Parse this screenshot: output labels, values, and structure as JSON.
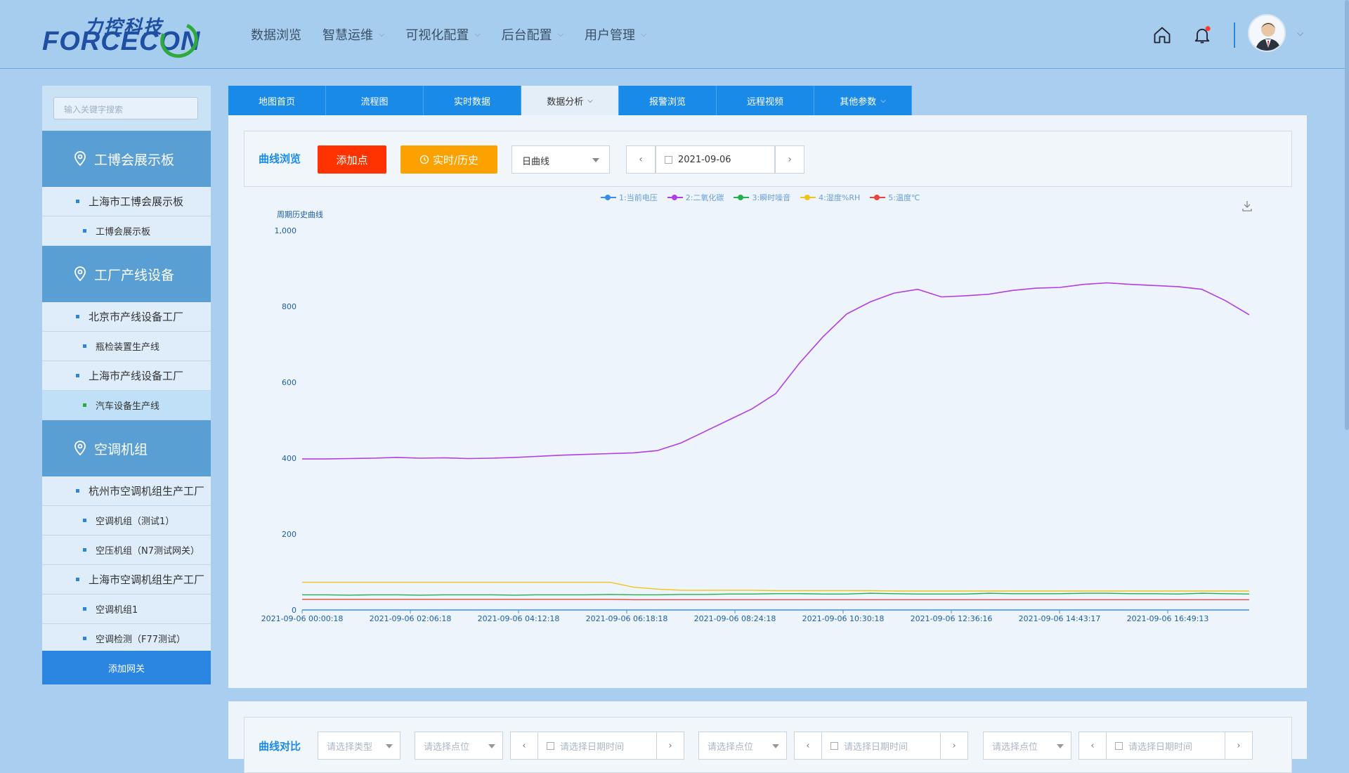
{
  "brand": {
    "cn": "力控科技",
    "en": "FORCECON"
  },
  "nav": [
    {
      "label": "数据浏览",
      "dropdown": false
    },
    {
      "label": "智慧运维",
      "dropdown": true
    },
    {
      "label": "可视化配置",
      "dropdown": true
    },
    {
      "label": "后台配置",
      "dropdown": true
    },
    {
      "label": "用户管理",
      "dropdown": true
    }
  ],
  "sidebar": {
    "search_placeholder": "输入关键字搜索",
    "groups": [
      {
        "title": "工博会展示板",
        "items": [
          {
            "label": "上海市工博会展示板",
            "level": 1
          },
          {
            "label": "工博会展示板",
            "level": 2
          }
        ]
      },
      {
        "title": "工厂产线设备",
        "items": [
          {
            "label": "北京市产线设备工厂",
            "level": 1
          },
          {
            "label": "瓶检装置生产线",
            "level": 2
          },
          {
            "label": "上海市产线设备工厂",
            "level": 1
          },
          {
            "label": "汽车设备生产线",
            "level": 2,
            "selected": true
          }
        ]
      },
      {
        "title": "空调机组",
        "items": [
          {
            "label": "杭州市空调机组生产工厂",
            "level": 1
          },
          {
            "label": "空调机组（测试1）",
            "level": 2
          },
          {
            "label": "空压机组（N7测试网关）",
            "level": 2
          },
          {
            "label": "上海市空调机组生产工厂",
            "level": 1
          },
          {
            "label": "空调机组1",
            "level": 2
          },
          {
            "label": "空调检测（F77测试）",
            "level": 2
          }
        ]
      }
    ],
    "add_button": "添加网关"
  },
  "tabs": [
    {
      "label": "地图首页"
    },
    {
      "label": "流程图"
    },
    {
      "label": "实时数据"
    },
    {
      "label": "数据分析",
      "active": true,
      "dropdown": true
    },
    {
      "label": "报警浏览"
    },
    {
      "label": "远程视频"
    },
    {
      "label": "其他参数",
      "dropdown": true
    }
  ],
  "toolbar": {
    "label": "曲线浏览",
    "add_point": "添加点",
    "realtime_history": "实时/历史",
    "curve_type": "日曲线",
    "date": "2021-09-06"
  },
  "chart_data": {
    "type": "line",
    "title": "周期历史曲线",
    "ylim": [
      0,
      1000
    ],
    "y_ticks": [
      "0",
      "200",
      "400",
      "600",
      "800",
      "1,000"
    ],
    "x_ticks": [
      "2021-09-06 00:00:18",
      "2021-09-06 02:06:18",
      "2021-09-06 04:12:18",
      "2021-09-06 06:18:18",
      "2021-09-06 08:24:18",
      "2021-09-06 10:30:18",
      "2021-09-06 12:36:16",
      "2021-09-06 14:43:17",
      "2021-09-06 16:49:13"
    ],
    "x": [
      0,
      1,
      2,
      3,
      4,
      5,
      6,
      7,
      8,
      9,
      10,
      11,
      12,
      13,
      14,
      15,
      16,
      17,
      18,
      19,
      20,
      21,
      22,
      23,
      24,
      25,
      26,
      27,
      28,
      29,
      30,
      31,
      32,
      33,
      34,
      35,
      36,
      37,
      38,
      39,
      40
    ],
    "series": [
      {
        "name": "1:当前电压",
        "color": "#3a8ee6",
        "values": [
          0,
          0,
          0,
          0,
          0,
          0,
          0,
          0,
          0,
          0,
          0,
          0,
          0,
          0,
          0,
          0,
          0,
          0,
          0,
          0,
          0,
          0,
          0,
          0,
          0,
          0,
          0,
          0,
          0,
          0,
          0,
          0,
          0,
          0,
          0,
          0,
          0,
          0,
          0,
          0,
          0
        ]
      },
      {
        "name": "2:二氧化碳",
        "color": "#b13ee6",
        "values": [
          398,
          398,
          399,
          400,
          402,
          400,
          401,
          399,
          400,
          402,
          405,
          408,
          410,
          412,
          414,
          420,
          440,
          470,
          500,
          530,
          570,
          650,
          720,
          780,
          812,
          835,
          845,
          825,
          828,
          832,
          842,
          848,
          850,
          858,
          862,
          858,
          855,
          852,
          845,
          815,
          778
        ]
      },
      {
        "name": "3:瞬时噪音",
        "color": "#22b14c",
        "values": [
          40,
          40,
          39,
          40,
          40,
          39,
          40,
          40,
          40,
          39,
          40,
          40,
          40,
          41,
          40,
          40,
          41,
          41,
          42,
          42,
          43,
          43,
          42,
          42,
          44,
          43,
          42,
          42,
          42,
          44,
          43,
          43,
          43,
          44,
          44,
          43,
          43,
          42,
          44,
          43,
          42
        ]
      },
      {
        "name": "4:湿度%RH",
        "color": "#f0c419",
        "values": [
          73,
          73,
          73,
          73,
          73,
          73,
          73,
          73,
          73,
          73,
          73,
          73,
          73,
          73,
          60,
          55,
          52,
          52,
          52,
          52,
          51,
          51,
          51,
          51,
          51,
          50,
          50,
          50,
          50,
          50,
          50,
          50,
          50,
          50,
          50,
          50,
          50,
          50,
          50,
          50,
          50
        ]
      },
      {
        "name": "5:温度℃",
        "color": "#e8483c",
        "values": [
          28,
          28,
          28,
          28,
          28,
          28,
          28,
          28,
          28,
          28,
          28,
          28,
          28,
          28,
          27,
          27,
          27,
          27,
          27,
          27,
          27,
          27,
          27,
          27,
          27,
          27,
          27,
          27,
          27,
          27,
          27,
          27,
          27,
          27,
          27,
          27,
          27,
          27,
          27,
          27,
          27
        ]
      }
    ],
    "legend_position": "top-center",
    "grid": false
  },
  "compare": {
    "label": "曲线对比",
    "type_placeholder": "请选择类型",
    "point_placeholder": "请选择点位",
    "datetime_placeholder": "请选择日期时间"
  },
  "icons": {
    "home": "home-icon",
    "bell": "bell-icon",
    "user": "avatar",
    "download": "download-icon",
    "location": "location-pin-icon"
  }
}
